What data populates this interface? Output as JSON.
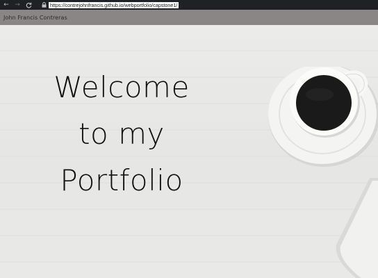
{
  "browser": {
    "url": "https://contrejohnfrancis.github.io/webportfolio/capstone1/",
    "back_glyph": "←",
    "forward_glyph": "→",
    "reload_glyph": "C"
  },
  "site": {
    "brand": "John Francis Contreras"
  },
  "hero": {
    "title_lines": [
      "Welcome",
      "to my",
      "Portfolio"
    ]
  },
  "colors": {
    "browser_bar": "#202124",
    "navbar": "#8a8685",
    "background": "#e8e8e6",
    "title": "#111111"
  }
}
